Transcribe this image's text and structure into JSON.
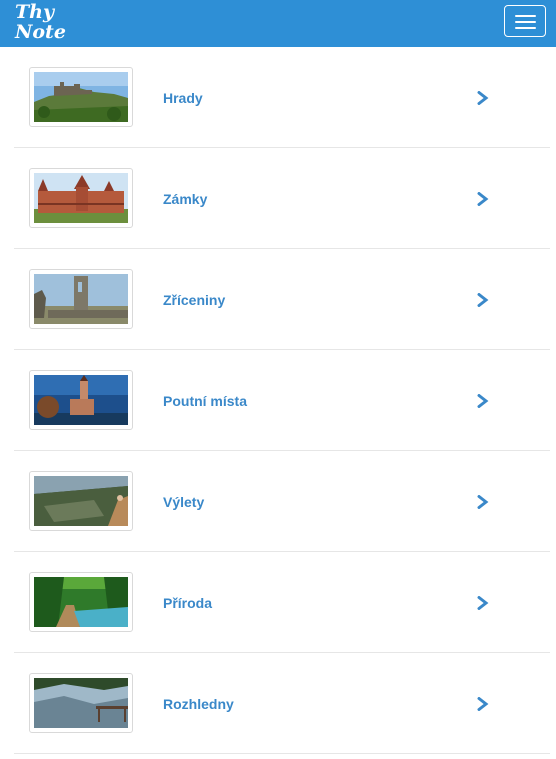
{
  "app": {
    "logo_line1": "Thy",
    "logo_line2": "Note"
  },
  "navbar": {
    "menu_icon": "hamburger-icon",
    "color": "#2e8fd6"
  },
  "categories": [
    {
      "label": "Hrady",
      "thumb": "castle-on-hill"
    },
    {
      "label": "Zámky",
      "thumb": "red-brick-chateau"
    },
    {
      "label": "Zříceniny",
      "thumb": "castle-ruin-tower"
    },
    {
      "label": "Poutní místa",
      "thumb": "church-at-dusk"
    },
    {
      "label": "Výlety",
      "thumb": "aerial-hiking"
    },
    {
      "label": "Příroda",
      "thumb": "forest-boardwalk"
    },
    {
      "label": "Rozhledny",
      "thumb": "lookout-view"
    }
  ],
  "colors": {
    "link": "#3a88c9",
    "divider": "#e6e6e6"
  },
  "row_icon": "chevron-right-icon"
}
